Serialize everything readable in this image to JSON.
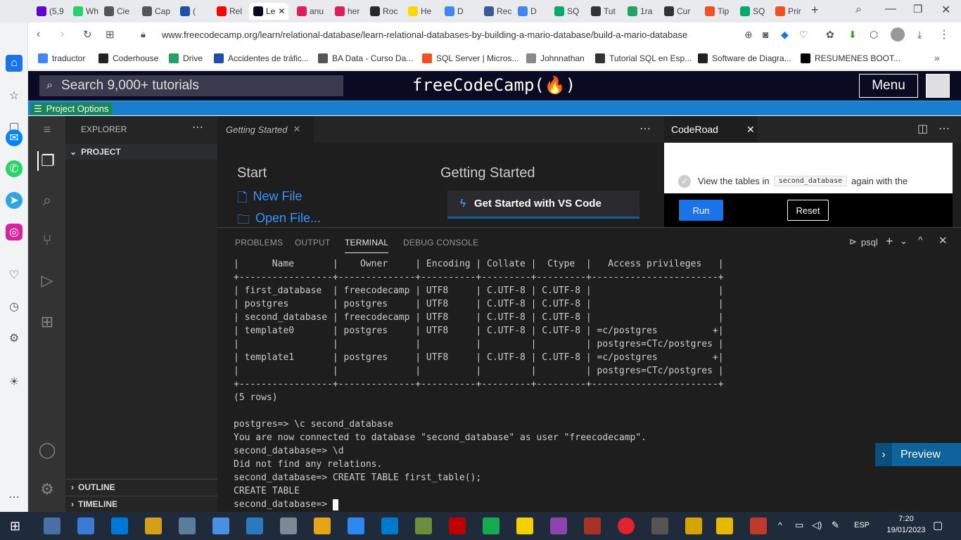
{
  "browser": {
    "tabs": [
      {
        "label": "(5,9",
        "color": "#6001d2"
      },
      {
        "label": "Wh",
        "color": "#25d366"
      },
      {
        "label": "Cie",
        "color": "#555555"
      },
      {
        "label": "Cap",
        "color": "#555555"
      },
      {
        "label": "(",
        "color": "#1f4fa8"
      },
      {
        "label": "Rel",
        "color": "#ff0000"
      },
      {
        "label": "Le",
        "color": "#0a0a23"
      },
      {
        "label": "anu",
        "color": "#e01e5a"
      },
      {
        "label": "her",
        "color": "#e01e5a"
      },
      {
        "label": "Roc",
        "color": "#24292e"
      },
      {
        "label": "He",
        "color": "#ffd700"
      },
      {
        "label": "D",
        "color": "#4285f4"
      },
      {
        "label": "Rec",
        "color": "#3b5998"
      },
      {
        "label": "D",
        "color": "#4285f4"
      },
      {
        "label": "SQ",
        "color": "#04aa6d"
      },
      {
        "label": "Tut",
        "color": "#333333"
      },
      {
        "label": "1ra",
        "color": "#1fa463"
      },
      {
        "label": "Cur",
        "color": "#333333"
      },
      {
        "label": "Tip",
        "color": "#f25022"
      },
      {
        "label": "SQ",
        "color": "#04aa6d"
      },
      {
        "label": "Prir",
        "color": "#f25022"
      }
    ],
    "url": "www.freecodecamp.org/learn/relational-database/learn-relational-databases-by-building-a-mario-database/build-a-mario-database",
    "bookmarks": [
      {
        "label": "traductor",
        "color": "#4285f4"
      },
      {
        "label": "Coderhouse",
        "color": "#222222"
      },
      {
        "label": "Drive",
        "color": "#1fa463"
      },
      {
        "label": "Accidentes de tráfic...",
        "color": "#1f4fa8"
      },
      {
        "label": "BA Data - Curso Da...",
        "color": "#555555"
      },
      {
        "label": "SQL Server | Micros...",
        "color": "#f25022"
      },
      {
        "label": "Johnnathan",
        "color": "#888888"
      },
      {
        "label": "Tutorial SQL en Esp...",
        "color": "#333333"
      },
      {
        "label": "Software de Diagra...",
        "color": "#222222"
      },
      {
        "label": "RESUMENES BOOT...",
        "color": "#000000"
      }
    ]
  },
  "fcc": {
    "search_placeholder": "Search 9,000+ tutorials",
    "logo": "freeCodeCamp(🔥)",
    "menu_label": "Menu",
    "project_options": "Project Options"
  },
  "explorer": {
    "title": "EXPLORER",
    "project": "PROJECT",
    "outline": "OUTLINE",
    "timeline": "TIMELINE"
  },
  "editor": {
    "tab_label": "Getting Started",
    "start_heading": "Start",
    "new_file": "New File",
    "open_file": "Open File...",
    "getting_started_heading": "Getting Started",
    "get_started_button": "Get Started with VS Code"
  },
  "coderoad": {
    "tab_label": "CodeRoad",
    "instruction_prefix": "View the tables in",
    "instruction_code": "second_database",
    "instruction_suffix": "again with the",
    "run_label": "Run",
    "reset_label": "Reset"
  },
  "panel": {
    "tabs": [
      "PROBLEMS",
      "OUTPUT",
      "TERMINAL",
      "DEBUG CONSOLE"
    ],
    "active_tab": "TERMINAL",
    "terminal_name": "psql",
    "preview_label": "Preview",
    "lines": [
      "|      Name       |    Owner     | Encoding | Collate |  Ctype  |   Access privileges   |",
      "+-----------------+--------------+----------+---------+---------+-----------------------+",
      "| first_database  | freecodecamp | UTF8     | C.UTF-8 | C.UTF-8 |                       |",
      "| postgres        | postgres     | UTF8     | C.UTF-8 | C.UTF-8 |                       |",
      "| second_database | freecodecamp | UTF8     | C.UTF-8 | C.UTF-8 |                       |",
      "| template0       | postgres     | UTF8     | C.UTF-8 | C.UTF-8 | =c/postgres          +|",
      "|                 |              |          |         |         | postgres=CTc/postgres |",
      "| template1       | postgres     | UTF8     | C.UTF-8 | C.UTF-8 | =c/postgres          +|",
      "|                 |              |          |         |         | postgres=CTc/postgres |",
      "+-----------------+--------------+----------+---------+---------+-----------------------+",
      "(5 rows)",
      "",
      "postgres=> \\c second_database",
      "You are now connected to database \"second_database\" as user \"freecodecamp\".",
      "second_database=> \\d",
      "Did not find any relations.",
      "second_database=> CREATE TABLE first_table();",
      "CREATE TABLE",
      "second_database=> "
    ]
  },
  "taskbar": {
    "time": "7:20",
    "date": "19/01/2023",
    "lang": "ESP"
  }
}
